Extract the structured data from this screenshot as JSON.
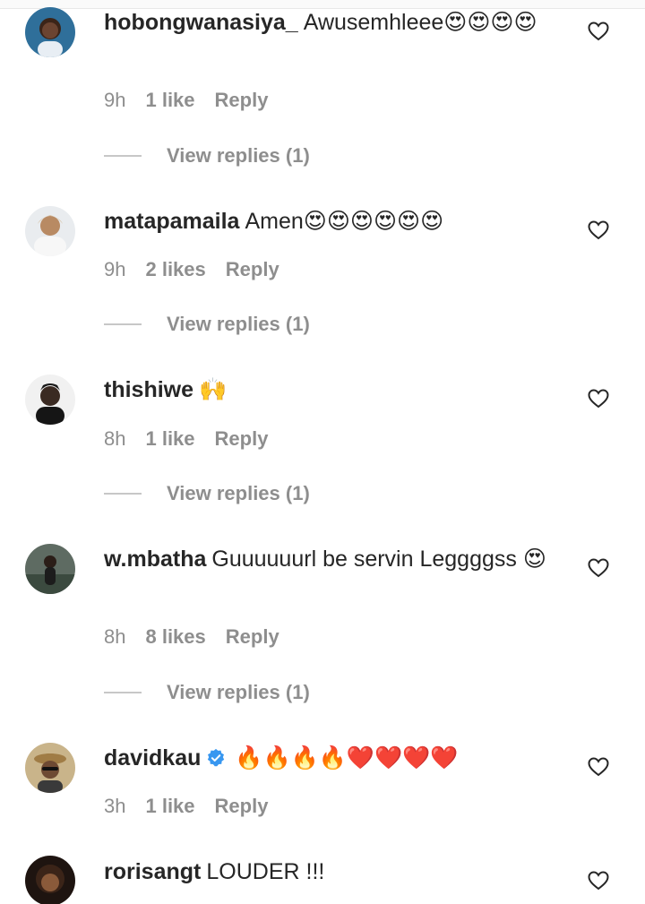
{
  "comments": [
    {
      "username": "hobongwanasiya_",
      "text": "Awusemhleee😍😍😍😍",
      "time": "9h",
      "likes": "1 like",
      "reply_label": "Reply",
      "view_replies": "View replies (1)"
    },
    {
      "username": "matapamaila",
      "text": "Amen😍😍😍😍😍😍",
      "time": "9h",
      "likes": "2 likes",
      "reply_label": "Reply",
      "view_replies": "View replies (1)"
    },
    {
      "username": "thishiwe",
      "text": "🙌",
      "time": "8h",
      "likes": "1 like",
      "reply_label": "Reply",
      "view_replies": "View replies (1)"
    },
    {
      "username": "w.mbatha",
      "text": "Guuuuuurl be servin Leggggss 😍",
      "time": "8h",
      "likes": "8 likes",
      "reply_label": "Reply",
      "view_replies": "View replies (1)"
    },
    {
      "username": "davidkau",
      "verified": true,
      "text": "🔥🔥🔥🔥❤️❤️❤️❤️",
      "time": "3h",
      "likes": "1 like",
      "reply_label": "Reply"
    },
    {
      "username": "rorisangt",
      "text": "LOUDER !!!"
    }
  ],
  "colors": {
    "primary_text": "#262626",
    "secondary_text": "#8e8e8e",
    "verified_badge": "#3897f0"
  },
  "icons": {
    "like": "heart-outline-icon",
    "verified": "verified-badge-icon"
  }
}
